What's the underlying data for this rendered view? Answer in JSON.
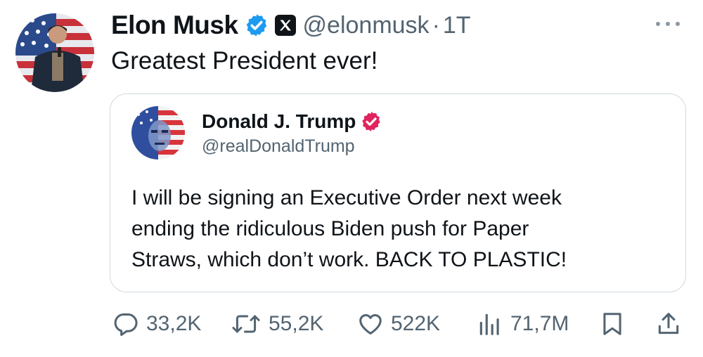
{
  "tweet": {
    "author_name": "Elon Musk",
    "author_handle": "@elonmusk",
    "separator": "·",
    "time": "1T",
    "text": "Greatest President ever!"
  },
  "quoted_tweet": {
    "author_name": "Donald J. Trump",
    "author_handle": "@realDonaldTrump",
    "text_lines": [
      "I will be signing an Executive Order next week",
      "ending the ridiculous Biden push for Paper",
      "Straws, which don’t work. BACK TO PLASTIC!"
    ]
  },
  "actions": {
    "replies": "33,2K",
    "reposts": "55,2K",
    "likes": "522K",
    "views": "71,7M"
  },
  "icons": {
    "verified": "verified-badge-icon",
    "affiliate": "x-logo-icon",
    "more": "more-icon",
    "reply": "reply-icon",
    "repost": "repost-icon",
    "like": "like-icon",
    "views": "views-icon",
    "bookmark": "bookmark-icon",
    "share": "share-icon"
  },
  "colors": {
    "verified_blue": "#1d9bf0",
    "verified_red": "#e0245e",
    "text": "#0f1419",
    "secondary": "#536471",
    "border": "#cfd9de"
  }
}
